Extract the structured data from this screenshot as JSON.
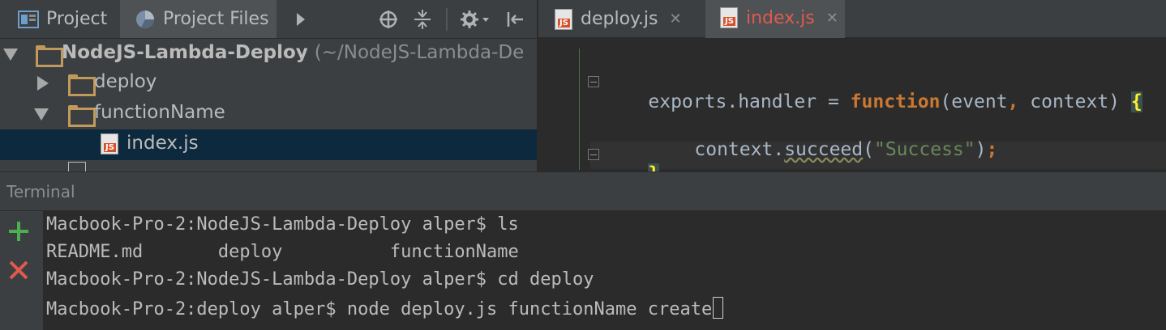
{
  "project_panel": {
    "tabs": [
      {
        "label": "Project",
        "icon": "project-icon"
      },
      {
        "label": "Project Files",
        "icon": "pie-chart-icon"
      }
    ],
    "toolbar_icons": [
      "chevron-right-icon",
      "crosshair-icon",
      "collapse-icon",
      "gear-icon",
      "hide-panel-icon"
    ],
    "tree": {
      "root": {
        "name": "NodeJS-Lambda-Deploy",
        "path": "(~/NodeJS-Lambda-De"
      },
      "items": [
        {
          "name": "deploy",
          "type": "folder",
          "expanded": false
        },
        {
          "name": "functionName",
          "type": "folder",
          "expanded": true
        },
        {
          "name": "index.js",
          "type": "js-file",
          "selected": true
        }
      ]
    }
  },
  "editor": {
    "tabs": [
      {
        "label": "deploy.js",
        "active": false
      },
      {
        "label": "index.js",
        "active": true
      }
    ],
    "code": {
      "line1": {
        "obj": "exports",
        "dot": ".",
        "prop": "handler",
        "eq": " = ",
        "kw": "function",
        "params": "(event",
        "comma": ",",
        "param2": " context) ",
        "brace": "{"
      },
      "line2": {
        "obj": "context",
        "dot": ".",
        "method": "succeed",
        "open": "(",
        "str": "\"Success\"",
        "close": ")",
        "semi": ";"
      },
      "line3": {
        "brace": "}"
      }
    }
  },
  "terminal": {
    "title": "Terminal",
    "lines": [
      "Macbook-Pro-2:NodeJS-Lambda-Deploy alper$ ls",
      "README.md       deploy          functionName",
      "Macbook-Pro-2:NodeJS-Lambda-Deploy alper$ cd deploy",
      "Macbook-Pro-2:deploy alper$ node deploy.js functionName create"
    ]
  },
  "colors": {
    "accent_red": "#e05a4e",
    "add_green": "#4caf50",
    "close_red": "#e05a4e",
    "folder": "#c19a5b",
    "selection": "#0d293e"
  }
}
